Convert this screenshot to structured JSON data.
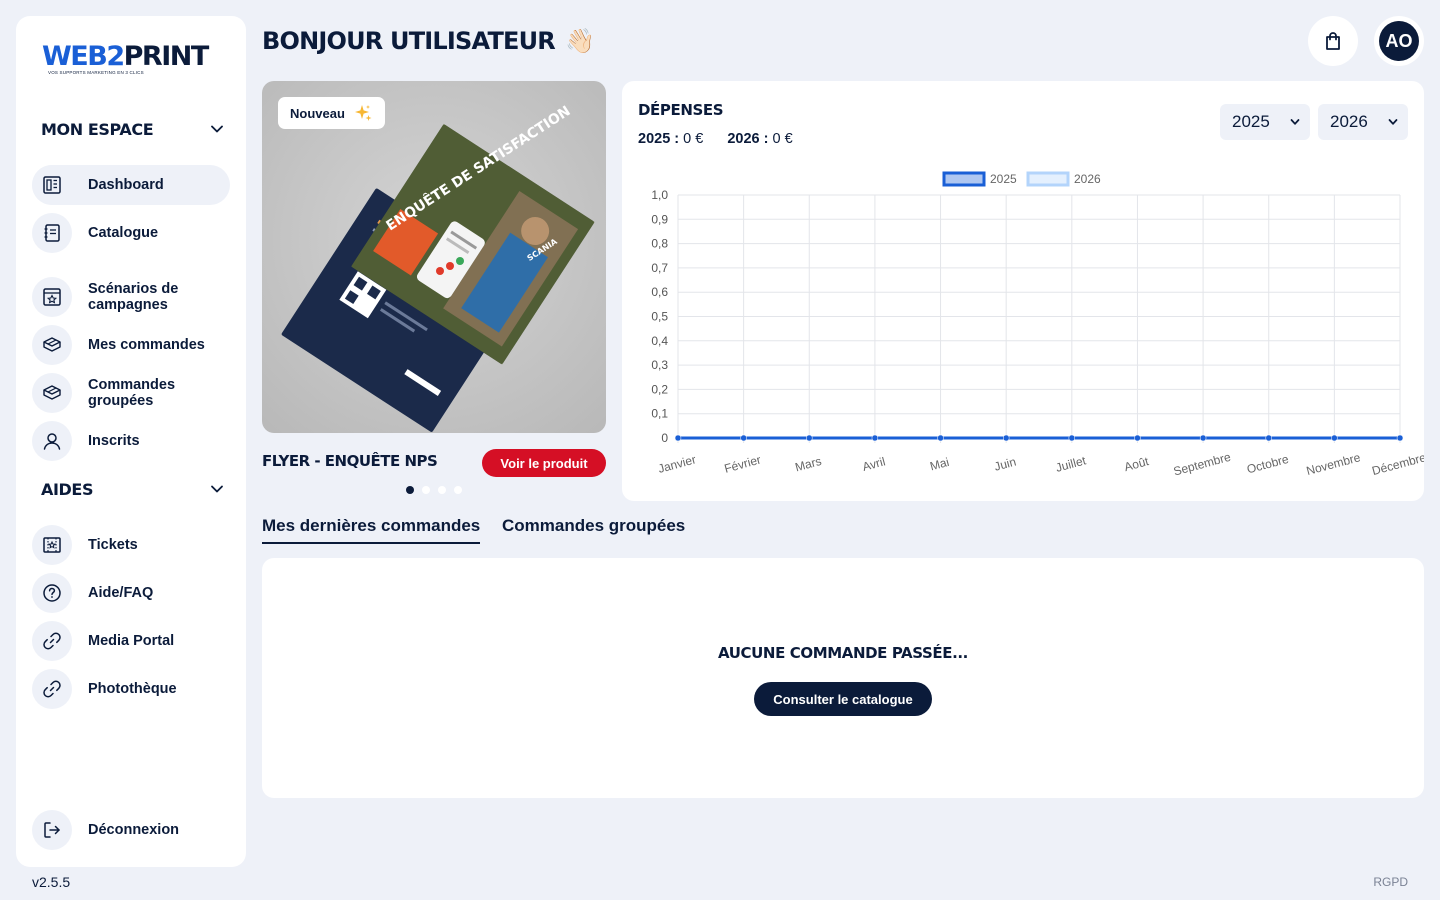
{
  "sidebar": {
    "logo": {
      "web": "WEB",
      "two": "2",
      "print": "PRINT",
      "tagline": "vos supports marketing en 3 clics"
    },
    "sections": [
      {
        "title": "MON ESPACE"
      },
      {
        "title": "AIDES"
      }
    ],
    "items": [
      {
        "label": "Dashboard",
        "icon": "dashboard-icon"
      },
      {
        "label": "Catalogue",
        "icon": "catalog-icon"
      },
      {
        "label": "Scénarios de\ncampagnes",
        "icon": "campaign-icon"
      },
      {
        "label": "Mes commandes",
        "icon": "box-icon"
      },
      {
        "label": "Commandes\ngroupées",
        "icon": "box-icon"
      },
      {
        "label": "Inscrits",
        "icon": "user-icon"
      },
      {
        "label": "Tickets",
        "icon": "ticket-icon"
      },
      {
        "label": "Aide/FAQ",
        "icon": "help-icon"
      },
      {
        "label": "Media Portal",
        "icon": "link-icon"
      },
      {
        "label": "Photothèque",
        "icon": "link-icon"
      },
      {
        "label": "Déconnexion",
        "icon": "logout-icon"
      }
    ],
    "version": "v2.5.5"
  },
  "header": {
    "greeting": "BONJOUR UTILISATEUR",
    "wave": "👋🏻",
    "avatar_initials": "AO"
  },
  "promo": {
    "badge": "Nouveau",
    "badge_icon": "sparkles-icon",
    "product_name": "FLYER - ENQUÊTE NPS",
    "cta": "Voir le produit",
    "flyer_heading": "ENQUÊTE DE SATISFACTION",
    "flyer_brand": "SCANIA",
    "slides": 4,
    "active_slide": 1
  },
  "expenses": {
    "title": "DÉPENSES",
    "totals": [
      {
        "year": "2025",
        "sep": " : ",
        "amount": "0 €"
      },
      {
        "year": "2026",
        "sep": " : ",
        "amount": "0 €"
      }
    ],
    "selects": [
      "2025",
      "2026"
    ]
  },
  "chart_data": {
    "type": "line",
    "categories": [
      "Janvier",
      "Février",
      "Mars",
      "Avril",
      "Mai",
      "Juin",
      "Juillet",
      "Août",
      "Septembre",
      "Octobre",
      "Novembre",
      "Décembre"
    ],
    "series": [
      {
        "name": "2025",
        "values": [
          0,
          0,
          0,
          0,
          0,
          0,
          0,
          0,
          0,
          0,
          0,
          0
        ],
        "color": "#1a5fd6"
      },
      {
        "name": "2026",
        "values": [
          0,
          0,
          0,
          0,
          0,
          0,
          0,
          0,
          0,
          0,
          0,
          0
        ],
        "color": "#b3d4fb"
      }
    ],
    "yticks": [
      "0",
      "0,1",
      "0,2",
      "0,3",
      "0,4",
      "0,5",
      "0,6",
      "0,7",
      "0,8",
      "0,9",
      "1,0"
    ],
    "ylim": [
      0,
      1
    ],
    "grid": true,
    "legend": "top"
  },
  "tabs": [
    {
      "label": "Mes dernières commandes",
      "active": true
    },
    {
      "label": "Commandes groupées",
      "active": false
    }
  ],
  "orders": {
    "empty_message": "AUCUNE COMMANDE PASSÉE...",
    "cta": "Consulter le catalogue"
  },
  "footer": {
    "rgpd": "RGPD"
  },
  "colors": {
    "navy": "#0b1b3a",
    "blue": "#1a5fd6",
    "light_blue": "#b3d4fb",
    "red": "#d50f25",
    "bg": "#eef1f8"
  }
}
